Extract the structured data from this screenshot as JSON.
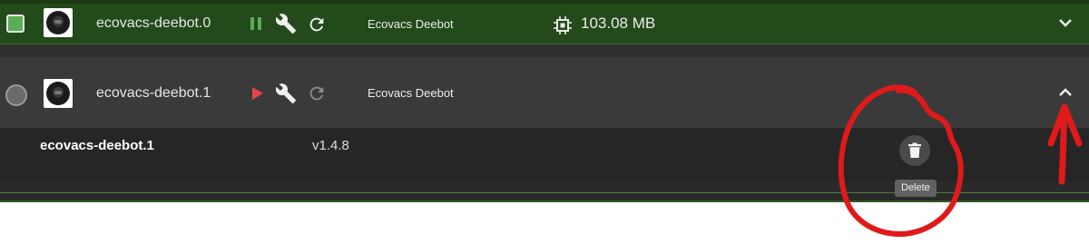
{
  "instances": [
    {
      "name": "ecovacs-deebot.0",
      "title": "Ecovacs Deebot",
      "memory": "103.08 MB",
      "enabled": true,
      "state_icon": "pause-icon",
      "expand_icon": "chevron-down-icon"
    },
    {
      "name": "ecovacs-deebot.1",
      "title": "Ecovacs Deebot",
      "enabled": false,
      "state_icon": "play-icon",
      "expand_icon": "chevron-up-icon"
    }
  ],
  "details": {
    "name": "ecovacs-deebot.1",
    "version": "v1.4.8",
    "delete_tooltip": "Delete"
  },
  "colors": {
    "row_running": "#234a1b",
    "row_selected": "#3a3a3a",
    "details_bg": "#262626",
    "pause_green": "#5aae55",
    "play_red": "#e24848",
    "annotation_red": "#e01a1a"
  }
}
